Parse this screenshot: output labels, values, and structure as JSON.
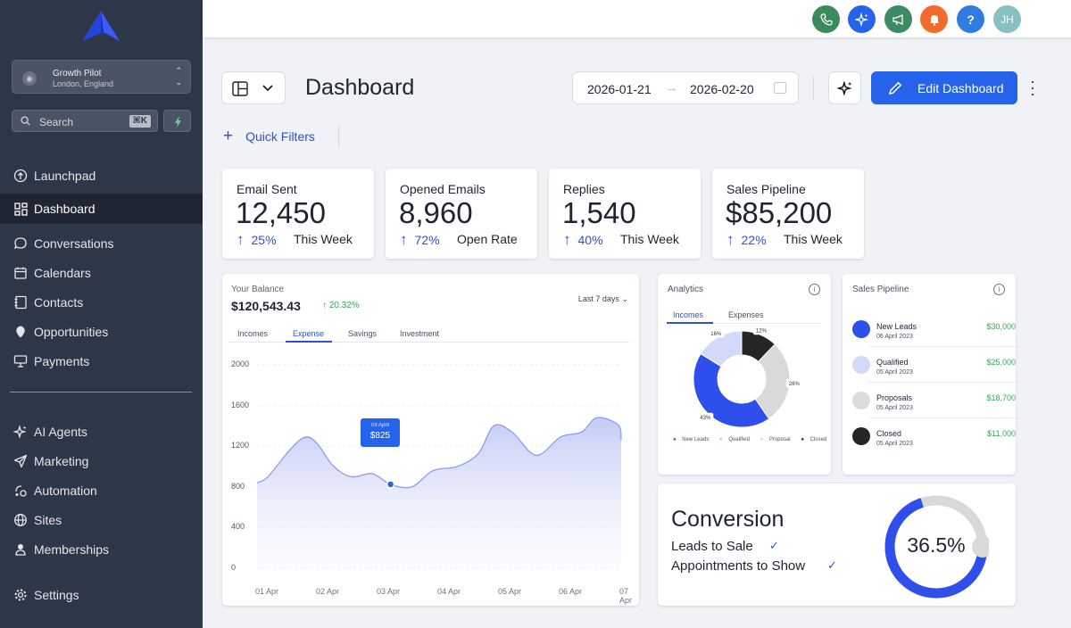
{
  "sidebar": {
    "account": {
      "name": "Growth Pilot",
      "location": "London, England"
    },
    "search": {
      "placeholder": "Search",
      "shortcut": "⌘K"
    },
    "items": [
      {
        "label": "Launchpad",
        "icon": "launchpad-icon"
      },
      {
        "label": "Dashboard",
        "icon": "dashboard-grid-icon",
        "active": true
      },
      {
        "label": "Conversations",
        "icon": "chat-bubble-icon"
      },
      {
        "label": "Calendars",
        "icon": "calendar-icon"
      },
      {
        "label": "Contacts",
        "icon": "contacts-book-icon"
      },
      {
        "label": "Opportunities",
        "icon": "opportunities-icon"
      },
      {
        "label": "Payments",
        "icon": "payments-icon"
      },
      {
        "label": "AI Agents",
        "icon": "sparkle-icon"
      },
      {
        "label": "Marketing",
        "icon": "send-icon"
      },
      {
        "label": "Automation",
        "icon": "automation-icon"
      },
      {
        "label": "Sites",
        "icon": "globe-icon"
      },
      {
        "label": "Memberships",
        "icon": "memberships-icon"
      },
      {
        "label": "Settings",
        "icon": "gear-icon"
      }
    ]
  },
  "topbar": {
    "buttons": [
      {
        "name": "phone-icon",
        "color": "#3b8a5a"
      },
      {
        "name": "sparkle-icon",
        "color": "#2563eb"
      },
      {
        "name": "megaphone-icon",
        "color": "#3d8a67"
      },
      {
        "name": "bell-icon",
        "color": "#f26b2a"
      },
      {
        "name": "help-icon",
        "label": "?",
        "color": "#2f7de1"
      }
    ],
    "avatar": {
      "initials": "JH",
      "color": "#86c1c0"
    }
  },
  "header": {
    "title": "Dashboard",
    "date_start": "2026-01-21",
    "date_end": "2026-02-20",
    "edit_label": "Edit Dashboard",
    "quick_filters": "Quick Filters"
  },
  "stats": [
    {
      "label": "Email Sent",
      "value": "12,450",
      "pct": "25%",
      "sub": "This Week"
    },
    {
      "label": "Opened Emails",
      "value": "8,960",
      "pct": "72%",
      "sub": "Open Rate"
    },
    {
      "label": "Replies",
      "value": "1,540",
      "pct": "40%",
      "sub": "This Week"
    },
    {
      "label": "Sales Pipeline",
      "value": "$85,200",
      "pct": "22%",
      "sub": "This Week"
    }
  ],
  "balance": {
    "title": "Your Balance",
    "value": "$120,543.43",
    "change": "20.32%",
    "period": "Last 7 days",
    "tabs": [
      "Incomes",
      "Expense",
      "Savings",
      "Investment"
    ],
    "active_tab": "Expense",
    "tooltip_date": "03 April",
    "tooltip_value": "$825"
  },
  "chart_data": {
    "type": "area",
    "x": [
      "01 Apr",
      "02 Apr",
      "03 Apr",
      "04 Apr",
      "05 Apr",
      "06 Apr",
      "07 Apr"
    ],
    "yticks": [
      "2000",
      "1600",
      "1200",
      "800",
      "400",
      "0"
    ],
    "ylim": [
      0,
      2000
    ],
    "series": [
      {
        "values_x": [
          0,
          0.18,
          0.55,
          0.8,
          1.0,
          1.25,
          1.55,
          1.9,
          2.2,
          2.55,
          2.9,
          3.3,
          3.65,
          3.9,
          4.2,
          4.6,
          5.0,
          5.35,
          5.6,
          5.95,
          6.0
        ],
        "values_y": [
          840,
          900,
          1170,
          1290,
          1220,
          1010,
          900,
          930,
          825,
          800,
          960,
          1000,
          1130,
          1400,
          1340,
          1110,
          1290,
          1340,
          1480,
          1410,
          1260
        ]
      }
    ],
    "highlight": {
      "x": 2.2,
      "y": 825
    },
    "grid": true
  },
  "analytics": {
    "title": "Analytics",
    "tabs": [
      "Incomes",
      "Expenses"
    ],
    "active_tab": "Incomes",
    "donut": [
      {
        "name": "New Leads",
        "value": 43,
        "label": "43%",
        "color": "#2f4fed"
      },
      {
        "name": "Qualified",
        "value": 16,
        "label": "16%",
        "color": "#d4d9fb"
      },
      {
        "name": "Proposal",
        "value": 28,
        "label": "28%",
        "color": "#d9d9d9"
      },
      {
        "name": "Closed",
        "value": 12,
        "label": "12%",
        "color": "#252525"
      }
    ],
    "legend": [
      "New Leads",
      "Qualified",
      "Proposal",
      "Closed"
    ]
  },
  "pipeline": {
    "title": "Sales Pipeline",
    "rows": [
      {
        "name": "New Leads",
        "date": "06 April 2023",
        "amount": "$30,000",
        "color": "#2f4fed"
      },
      {
        "name": "Qualified",
        "date": "05 April 2023",
        "amount": "$25,000",
        "color": "#d4d9fb"
      },
      {
        "name": "Proposals",
        "date": "05 April 2023",
        "amount": "$18,700",
        "color": "#dcdcdc"
      },
      {
        "name": "Closed",
        "date": "05 April 2023",
        "amount": "$11,000",
        "color": "#252525"
      }
    ]
  },
  "conversion": {
    "title": "Conversion",
    "line1": "Leads to Sale",
    "line2": "Appointments to Show",
    "value_label": "36.5%",
    "ring_fraction": 0.7
  }
}
